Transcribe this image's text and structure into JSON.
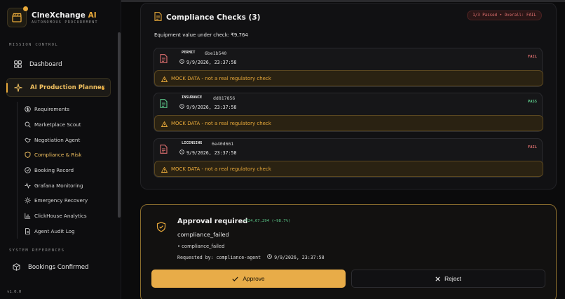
{
  "brand": {
    "name": "CineXchange",
    "name_accent": "AI",
    "subtitle": "AUTONOMOUS PROCUREMENT"
  },
  "sidebar": {
    "section_mission": "MISSION CONTROL",
    "section_system": "SYSTEM REFERENCES",
    "main_items": [
      {
        "label": "Dashboard",
        "icon": "grid-icon"
      },
      {
        "label": "AI Production Planner",
        "icon": "sparkle-icon"
      }
    ],
    "sub_items": [
      {
        "label": "Requirements",
        "icon": "dollar-circle-icon"
      },
      {
        "label": "Marketplace Scout",
        "icon": "search-icon"
      },
      {
        "label": "Negotiation Agent",
        "icon": "handshake-icon"
      },
      {
        "label": "Compliance & Risk",
        "icon": "shield-icon"
      },
      {
        "label": "Booking Record",
        "icon": "check-circle-icon"
      },
      {
        "label": "Grafana Monitoring",
        "icon": "activity-icon"
      },
      {
        "label": "Emergency Recovery",
        "icon": "sun-icon"
      },
      {
        "label": "ClickHouse Analytics",
        "icon": "bar-chart-icon"
      },
      {
        "label": "Agent Audit Log",
        "icon": "document-icon"
      }
    ],
    "system_items": [
      {
        "label": "Bookings Confirmed",
        "icon": "cube-icon"
      }
    ],
    "version": "v1.0.0"
  },
  "compliance": {
    "title": "Compliance Checks (3)",
    "status": "1/3 Passed • Overall: FAIL",
    "equipment_label": "Equipment value under check: ₹9,764",
    "mock_text": "MOCK DATA - not a real regulatory check",
    "checks": [
      {
        "type": "PERMIT",
        "hash": "6be1b540",
        "time": "9/9/2026, 23:37:58",
        "result": "FAIL"
      },
      {
        "type": "INSURANCE",
        "hash": "dd817856",
        "time": "9/9/2026, 23:37:58",
        "result": "PASS"
      },
      {
        "type": "LICENSING",
        "hash": "6e40d661",
        "time": "9/9/2026, 23:37:58",
        "result": "FAIL"
      }
    ]
  },
  "approval": {
    "title": "Approval required",
    "delta": "−₹24,67,294 (−98.7%)",
    "reason": "compliance_failed",
    "bullet": "• compliance_failed",
    "requested_by": "Requested by: compliance-agent",
    "requested_time": "9/9/2026, 23:37:58",
    "approve_label": "Approve",
    "reject_label": "Reject"
  },
  "colors": {
    "accent": "#e8a93a",
    "fail": "#e07070",
    "pass": "#5cc98a",
    "background": "#0b0b0c"
  }
}
